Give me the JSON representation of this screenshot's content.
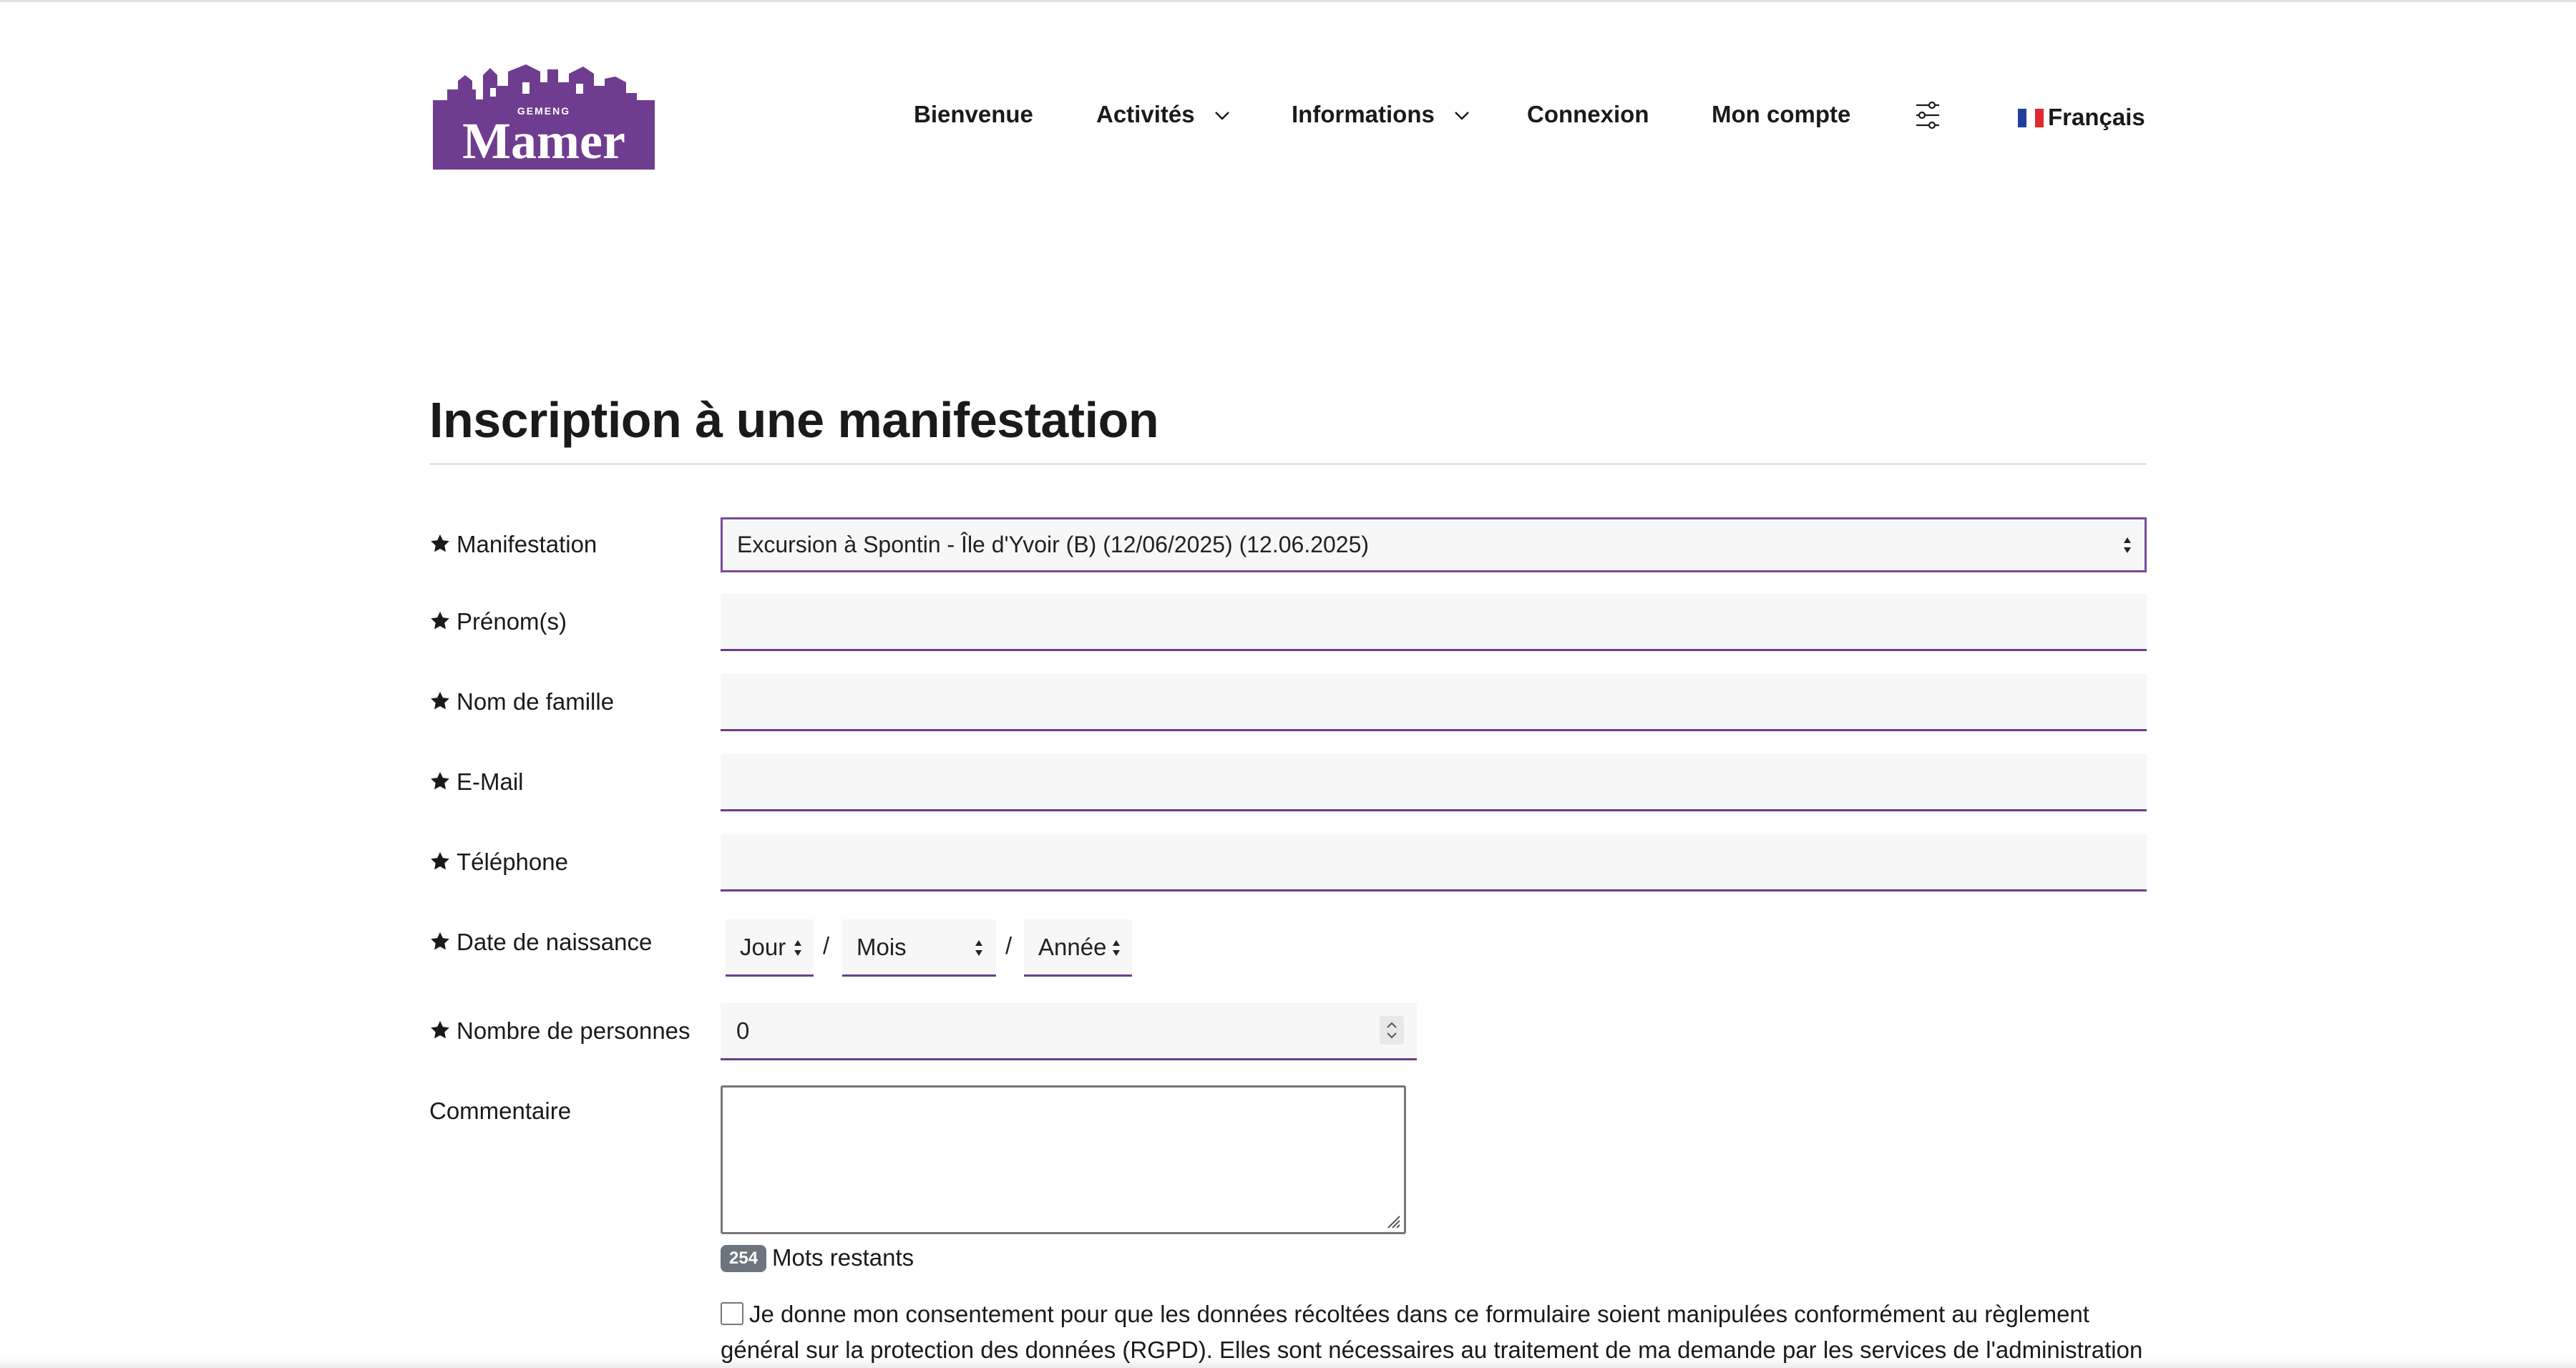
{
  "header": {
    "logo": {
      "small_text": "GEMENG",
      "big_text": "Mamer",
      "color": "#6f3d8f"
    },
    "nav": [
      {
        "label": "Bienvenue",
        "has_dropdown": false
      },
      {
        "label": "Activités",
        "has_dropdown": true
      },
      {
        "label": "Informations",
        "has_dropdown": true
      },
      {
        "label": "Connexion",
        "has_dropdown": false
      },
      {
        "label": "Mon compte",
        "has_dropdown": false
      }
    ],
    "settings_icon": "sliders-icon",
    "language": {
      "label": "Français",
      "flag": "fr-flag-icon"
    }
  },
  "page": {
    "title": "Inscription à une manifestation"
  },
  "form": {
    "manifestation": {
      "label": "Manifestation",
      "value": "Excursion à Spontin - Île d'Yvoir (B) (12/06/2025) (12.06.2025)"
    },
    "prenom": {
      "label": "Prénom(s)",
      "value": ""
    },
    "nom": {
      "label": "Nom de famille",
      "value": ""
    },
    "email": {
      "label": "E-Mail",
      "value": ""
    },
    "telephone": {
      "label": "Téléphone",
      "value": ""
    },
    "date_naissance": {
      "label": "Date de naissance",
      "day": "Jour",
      "month": "Mois",
      "year": "Année",
      "separator": "/"
    },
    "personnes": {
      "label": "Nombre de personnes",
      "value": "0"
    },
    "commentaire": {
      "label": "Commentaire",
      "value": "",
      "remaining_count": "254",
      "remaining_label": "Mots restants"
    },
    "consent": {
      "text": "Je donne mon consentement pour que les données récoltées dans ce formulaire soient manipulées conformément au règlement général sur la protection des données (RGPD). Elles sont nécessaires au traitement de ma demande par les services de l'administration communale de"
    }
  },
  "colors": {
    "accent": "#6a3d8a",
    "badge": "#6c757d",
    "field_bg": "#f7f7f7"
  }
}
